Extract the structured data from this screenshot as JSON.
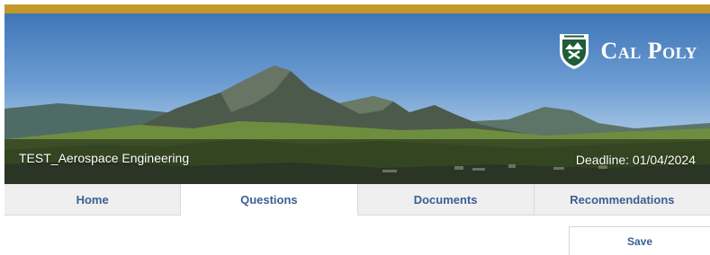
{
  "header": {
    "brand": "Cal Poly",
    "program_title": "TEST_Aerospace Engineering",
    "deadline": "Deadline: 01/04/2024"
  },
  "tabs": [
    {
      "label": "Home",
      "active": false
    },
    {
      "label": "Questions",
      "active": true
    },
    {
      "label": "Documents",
      "active": false
    },
    {
      "label": "Recommendations",
      "active": false
    }
  ],
  "actions": {
    "save_label": "Save"
  },
  "colors": {
    "gold": "#c4982a",
    "tab_text": "#3a5f93",
    "tab_bg": "#efefef",
    "logo_green": "#1f5c3a"
  },
  "icons": {
    "logo": "cal-poly-shield-icon"
  }
}
